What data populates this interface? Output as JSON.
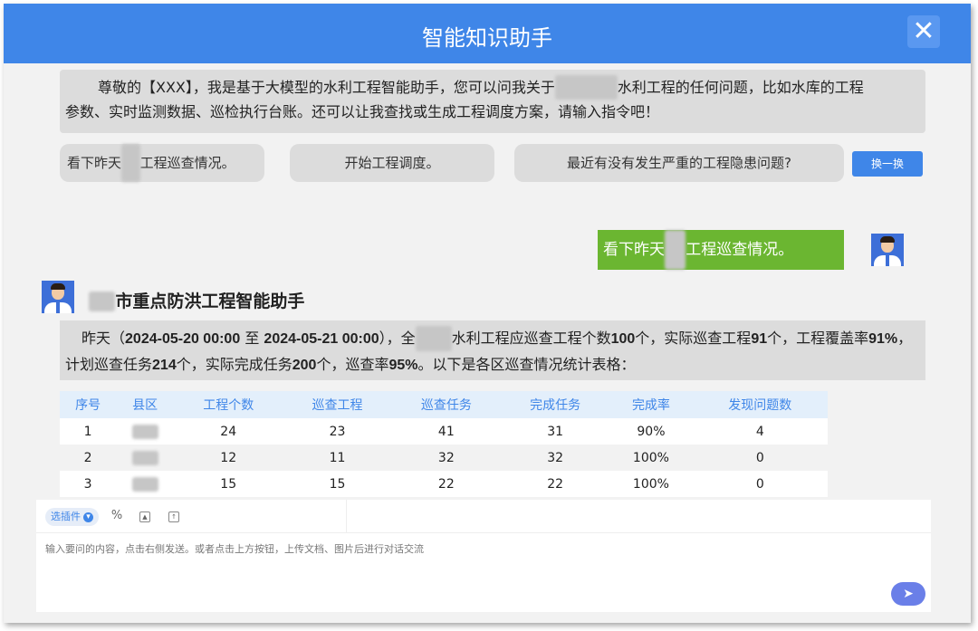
{
  "header": {
    "title": "智能知识助手",
    "close_label": "✕"
  },
  "greeting": {
    "line1_a": "尊敬的【XXX】，我是基于大模型的水利工程智能助手，您可以问我关于",
    "line1_b": "水利工程的任何问题，比如水库的工程",
    "line2": "参数、实时监测数据、巡检执行台账。还可以让我查找或生成工程调度方案，请输入指令吧！"
  },
  "suggestions": [
    {
      "pre": "看下昨天",
      "post": "工程巡查情况。"
    },
    {
      "pre": "开始工程调度。",
      "post": ""
    },
    {
      "pre": "最近有没有发生严重的工程隐患问题?",
      "post": ""
    }
  ],
  "swap_label": "换一换",
  "user_message": {
    "pre": "看下昨天",
    "post": "工程巡查情况。"
  },
  "bot": {
    "name_suffix": "市重点防洪工程智能助手",
    "msg": {
      "t1": "昨天（",
      "b1": "2024-05-20 00:00",
      "t2": " 至 ",
      "b2": "2024-05-21 00:00",
      "t3": "），全",
      "t4": "水利工程应巡查工程个数",
      "b3": "100",
      "t5": "个，实际巡查工程",
      "b4": "91",
      "t6": "个，工程覆盖率",
      "b5": "91%",
      "t7": "，计划巡查任务",
      "b6": "214",
      "t8": "个，实际完成任务",
      "b7": "200",
      "t9": "个，巡查率",
      "b8": "95%",
      "t10": "。以下是各区巡查情况统计表格："
    }
  },
  "table": {
    "headers": [
      "序号",
      "县区",
      "工程个数",
      "巡查工程",
      "巡查任务",
      "完成任务",
      "完成率",
      "发现问题数"
    ],
    "rows": [
      [
        "1",
        "",
        "24",
        "23",
        "41",
        "31",
        "90%",
        "4"
      ],
      [
        "2",
        "",
        "12",
        "11",
        "32",
        "32",
        "100%",
        "0"
      ],
      [
        "3",
        "",
        "15",
        "15",
        "22",
        "22",
        "100%",
        "0"
      ]
    ]
  },
  "input": {
    "plugin_label": "选插件",
    "placeholder": "输入要问的内容，点击右侧发送。或者点击上方按钮，上传文档、图片后进行对话交流"
  },
  "colors": {
    "header": "#3f86e8",
    "user_bubble": "#6bb631",
    "table_header_text": "#3f86e8",
    "send_button": "#6a7fe8"
  }
}
